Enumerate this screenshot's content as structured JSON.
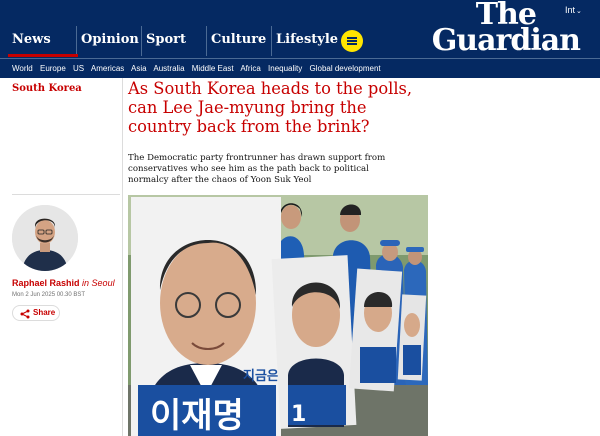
{
  "header": {
    "logo_line1": "The",
    "logo_line2": "Guardian",
    "edition": "Int",
    "pillars": [
      "News",
      "Opinion",
      "Sport",
      "Culture",
      "Lifestyle"
    ],
    "subnav": [
      "World",
      "Europe",
      "US",
      "Americas",
      "Asia",
      "Australia",
      "Middle East",
      "Africa",
      "Inequality",
      "Global development"
    ]
  },
  "article": {
    "section": "South Korea",
    "headline": "As South Korea heads to the polls, can Lee Jae-myung bring the country back from the brink?",
    "standfirst": "The Democratic party frontrunner has drawn support from conservatives who see him as the path back to political normalcy after the chaos of Yoon Suk Yeol",
    "author": "Raphael Rashid",
    "author_location": "in Seoul",
    "date": "Mon 2 Jun 2025 00.30 BST",
    "share_label": "Share",
    "poster_text_main": "이재명",
    "poster_text_small": "지금은",
    "poster_number": "1"
  },
  "colors": {
    "brand_blue": "#052962",
    "accent_red": "#c70000",
    "menu_yellow": "#ffe500"
  }
}
